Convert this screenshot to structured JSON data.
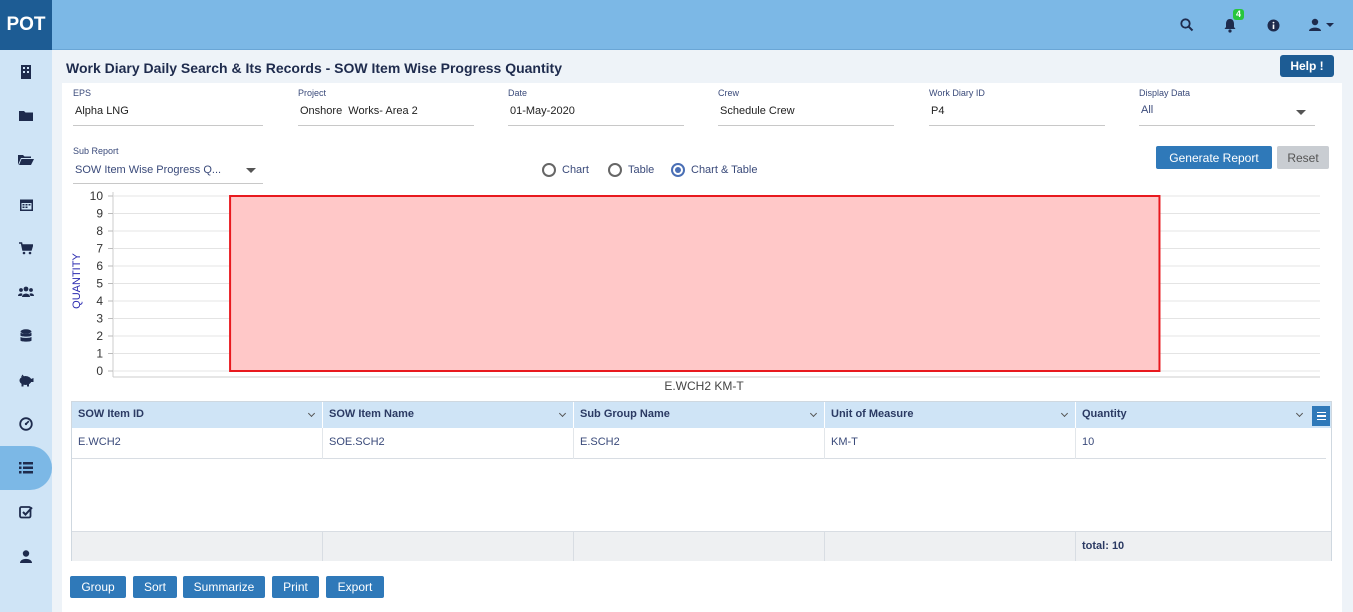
{
  "app": {
    "logo": "POT"
  },
  "topbar": {
    "icons": [
      "search-icon",
      "bell-icon",
      "info-icon",
      "user-icon"
    ],
    "notification_count": "4"
  },
  "sidebar": {
    "items": [
      {
        "icon": "building-icon"
      },
      {
        "icon": "folder-icon"
      },
      {
        "icon": "folder-open-icon"
      },
      {
        "icon": "calendar-icon"
      },
      {
        "icon": "cart-icon"
      },
      {
        "icon": "users-icon"
      },
      {
        "icon": "database-icon"
      },
      {
        "icon": "piggy-bank-icon"
      },
      {
        "icon": "dashboard-icon"
      },
      {
        "icon": "list-icon",
        "active": true
      },
      {
        "icon": "checkbox-icon"
      },
      {
        "icon": "user-icon"
      }
    ]
  },
  "page": {
    "title": "Work Diary Daily Search & Its Records - SOW Item Wise Progress Quantity",
    "help_label": "Help !"
  },
  "filters": {
    "eps": {
      "label": "EPS",
      "value": "Alpha LNG"
    },
    "project": {
      "label": "Project",
      "value": "Onshore  Works- Area 2"
    },
    "date": {
      "label": "Date",
      "value": "01-May-2020"
    },
    "crew": {
      "label": "Crew",
      "value": "Schedule Crew"
    },
    "work_diary_id": {
      "label": "Work Diary ID",
      "value": "P4"
    },
    "display_data": {
      "label": "Display Data",
      "value": "All"
    },
    "sub_report": {
      "label": "Sub Report",
      "value": "SOW Item Wise Progress Q..."
    }
  },
  "view_options": {
    "chart": "Chart",
    "table": "Table",
    "chart_table": "Chart & Table",
    "selected": "chart_table"
  },
  "buttons": {
    "generate": "Generate Report",
    "reset": "Reset",
    "group": "Group",
    "sort": "Sort",
    "summarize": "Summarize",
    "print": "Print",
    "export": "Export"
  },
  "colors": {
    "bar_fill": "#ffc8c8",
    "bar_stroke": "#e8191e",
    "accent": "#2f79b9",
    "topbar": "#7cb8e6"
  },
  "chart_data": {
    "type": "bar",
    "categories": [
      "E.WCH2 KM-T"
    ],
    "values": [
      10
    ],
    "ylabel": "QUANTITY",
    "xlabel": "",
    "ylim": [
      0,
      10
    ],
    "yticks": [
      0,
      1,
      2,
      3,
      4,
      5,
      6,
      7,
      8,
      9,
      10
    ],
    "grid": true
  },
  "table": {
    "columns": [
      "SOW Item ID",
      "SOW Item Name",
      "Sub Group Name",
      "Unit of Measure",
      "Quantity"
    ],
    "rows": [
      [
        "E.WCH2",
        "SOE.SCH2",
        "E.SCH2",
        "KM-T",
        "10"
      ]
    ],
    "footer_total": "total: 10"
  }
}
